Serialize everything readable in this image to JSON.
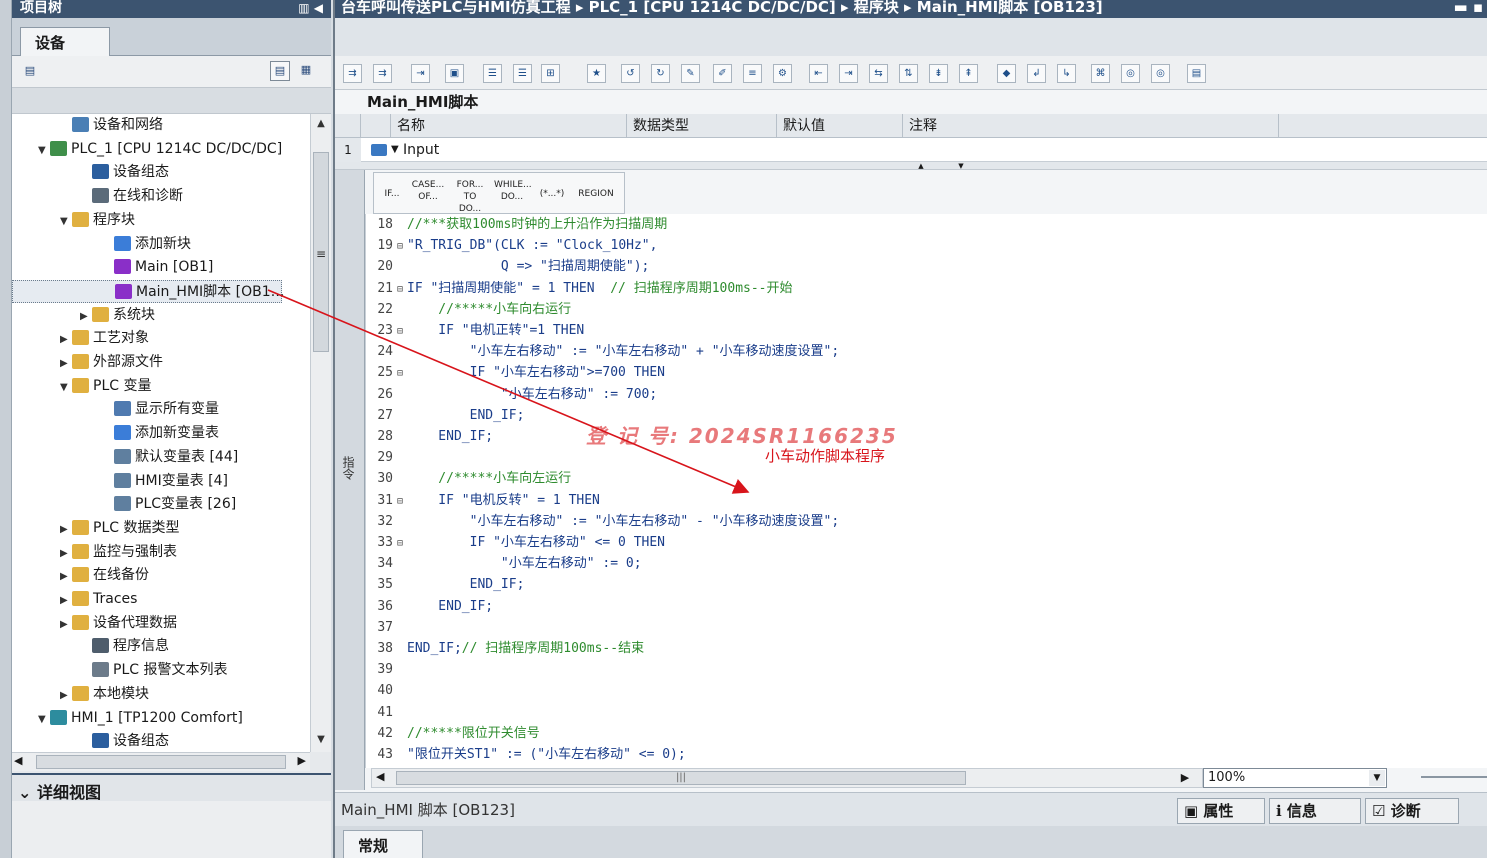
{
  "project_tree": {
    "title": "项目树",
    "tab_label": "设备",
    "nodes": [
      {
        "label": "设备和网络",
        "icon": "network-icon",
        "toggle": "",
        "level": 2
      },
      {
        "label": "PLC_1 [CPU 1214C DC/DC/DC]",
        "icon": "plc-icon",
        "toggle": "▼",
        "level": 1
      },
      {
        "label": "设备组态",
        "icon": "device-config-icon",
        "toggle": "",
        "level": 3
      },
      {
        "label": "在线和诊断",
        "icon": "online-diagnose-icon",
        "toggle": "",
        "level": 3
      },
      {
        "label": "程序块",
        "icon": "folder-icon",
        "toggle": "▼",
        "level": 2
      },
      {
        "label": "添加新块",
        "icon": "add-block-icon",
        "toggle": "",
        "level": 4
      },
      {
        "label": "Main [OB1]",
        "icon": "ob-block-icon",
        "toggle": "",
        "level": 4
      },
      {
        "label": "Main_HMI脚本 [OB1…",
        "icon": "ob-block-icon",
        "toggle": "",
        "level": 4
      },
      {
        "label": "系统块",
        "icon": "folder-icon",
        "toggle": "▶",
        "level": 3
      },
      {
        "label": "工艺对象",
        "icon": "folder-icon",
        "toggle": "▶",
        "level": 2
      },
      {
        "label": "外部源文件",
        "icon": "folder-icon",
        "toggle": "▶",
        "level": 2
      },
      {
        "label": "PLC 变量",
        "icon": "folder-icon",
        "toggle": "▼",
        "level": 2
      },
      {
        "label": "显示所有变量",
        "icon": "show-tags-icon",
        "toggle": "",
        "level": 4
      },
      {
        "label": "添加新变量表",
        "icon": "add-table-icon",
        "toggle": "",
        "level": 4
      },
      {
        "label": "默认变量表 [44]",
        "icon": "tag-table-icon",
        "toggle": "",
        "level": 4
      },
      {
        "label": "HMI变量表 [4]",
        "icon": "tag-table-icon",
        "toggle": "",
        "level": 4
      },
      {
        "label": "PLC变量表 [26]",
        "icon": "tag-table-icon",
        "toggle": "",
        "level": 4
      },
      {
        "label": "PLC 数据类型",
        "icon": "folder-icon",
        "toggle": "▶",
        "level": 2
      },
      {
        "label": "监控与强制表",
        "icon": "folder-icon",
        "toggle": "▶",
        "level": 2
      },
      {
        "label": "在线备份",
        "icon": "folder-icon",
        "toggle": "▶",
        "level": 2
      },
      {
        "label": "Traces",
        "icon": "folder-icon",
        "toggle": "▶",
        "level": 2
      },
      {
        "label": "设备代理数据",
        "icon": "folder-icon",
        "toggle": "▶",
        "level": 2
      },
      {
        "label": "程序信息",
        "icon": "program-info-icon",
        "toggle": "",
        "level": 3
      },
      {
        "label": "PLC 报警文本列表",
        "icon": "alarm-text-icon",
        "toggle": "",
        "level": 3
      },
      {
        "label": "本地模块",
        "icon": "folder-icon",
        "toggle": "▶",
        "level": 2
      },
      {
        "label": "HMI_1 [TP1200 Comfort]",
        "icon": "hmi-icon",
        "toggle": "▼",
        "level": 1
      },
      {
        "label": "设备组态",
        "icon": "device-config-icon",
        "toggle": "",
        "level": 3
      }
    ],
    "detail_view_label": "详细视图"
  },
  "editor": {
    "breadcrumb": [
      "台车呼叫传送PLC与HMI仿真工程",
      "PLC_1 [CPU 1214C DC/DC/DC]",
      "程序块",
      "Main_HMI脚本 [OB123]"
    ],
    "block_title": "Main_HMI脚本",
    "interface_columns": [
      "名称",
      "数据类型",
      "默认值",
      "注释"
    ],
    "interface_row": {
      "num": "1",
      "toggle": "▼",
      "label": "Input"
    },
    "snippets": [
      "IF...",
      "CASE... OF...",
      "FOR... TO DO...",
      "WHILE... DO...",
      "(*...*)",
      "REGION"
    ],
    "side_tab": "指令",
    "code_lines": [
      {
        "ln": "18",
        "fold": "",
        "text": "//***获取100ms时钟的上升沿作为扫描周期",
        "kind": "cmt"
      },
      {
        "ln": "19",
        "fold": "⊟",
        "text": "\"R_TRIG_DB\"(CLK := \"Clock_10Hz\",",
        "kind": "txt"
      },
      {
        "ln": "20",
        "fold": "",
        "text": "            Q => \"扫描周期使能\");",
        "kind": "txt"
      },
      {
        "ln": "21",
        "fold": "⊟",
        "text": "IF \"扫描周期使能\" = 1 THEN  // 扫描程序周期100ms--开始",
        "kind": "mix",
        "cmt_start": 22
      },
      {
        "ln": "22",
        "fold": "",
        "text": "    //*****小车向右运行",
        "kind": "cmt"
      },
      {
        "ln": "23",
        "fold": "⊟",
        "text": "    IF \"电机正转\"=1 THEN",
        "kind": "txt"
      },
      {
        "ln": "24",
        "fold": "",
        "text": "        \"小车左右移动\" := \"小车左右移动\" + \"小车移动速度设置\";",
        "kind": "txt"
      },
      {
        "ln": "25",
        "fold": "⊟",
        "text": "        IF \"小车左右移动\">=700 THEN",
        "kind": "txt"
      },
      {
        "ln": "26",
        "fold": "",
        "text": "            \"小车左右移动\" := 700;",
        "kind": "txt"
      },
      {
        "ln": "27",
        "fold": "",
        "text": "        END_IF;",
        "kind": "txt"
      },
      {
        "ln": "28",
        "fold": "",
        "text": "    END_IF;",
        "kind": "txt"
      },
      {
        "ln": "29",
        "fold": "",
        "text": "",
        "kind": "txt"
      },
      {
        "ln": "30",
        "fold": "",
        "text": "    //*****小车向左运行",
        "kind": "cmt"
      },
      {
        "ln": "31",
        "fold": "⊟",
        "text": "    IF \"电机反转\" = 1 THEN",
        "kind": "txt"
      },
      {
        "ln": "32",
        "fold": "",
        "text": "        \"小车左右移动\" := \"小车左右移动\" - \"小车移动速度设置\";",
        "kind": "txt"
      },
      {
        "ln": "33",
        "fold": "⊟",
        "text": "        IF \"小车左右移动\" <= 0 THEN",
        "kind": "txt"
      },
      {
        "ln": "34",
        "fold": "",
        "text": "            \"小车左右移动\" := 0;",
        "kind": "txt"
      },
      {
        "ln": "35",
        "fold": "",
        "text": "        END_IF;",
        "kind": "txt"
      },
      {
        "ln": "36",
        "fold": "",
        "text": "    END_IF;",
        "kind": "txt"
      },
      {
        "ln": "37",
        "fold": "",
        "text": "",
        "kind": "txt"
      },
      {
        "ln": "38",
        "fold": "",
        "text": "END_IF;// 扫描程序周期100ms--结束",
        "kind": "mix",
        "cmt_start": 7
      },
      {
        "ln": "39",
        "fold": "",
        "text": "",
        "kind": "txt"
      },
      {
        "ln": "40",
        "fold": "",
        "text": "",
        "kind": "txt"
      },
      {
        "ln": "41",
        "fold": "",
        "text": "",
        "kind": "txt"
      },
      {
        "ln": "42",
        "fold": "",
        "text": "//*****限位开关信号",
        "kind": "cmt"
      },
      {
        "ln": "43",
        "fold": "",
        "text": "\"限位开关ST1\" := (\"小车左右移动\" <= 0);",
        "kind": "txt"
      }
    ],
    "watermark": "登 记 号: 2024SR1166235",
    "annotation": "小车动作脚本程序",
    "zoom": "100%",
    "status_name": "Main_HMI 脚本 [OB123]",
    "status_tabs": [
      "属性",
      "信息",
      "诊断"
    ],
    "bottom_tab": "常规"
  },
  "colors": {
    "arrow": "#d8141b",
    "title_bar": "#3c5470"
  }
}
